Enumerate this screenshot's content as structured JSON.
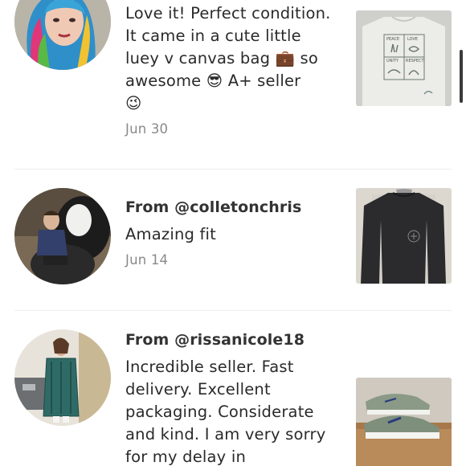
{
  "reviews": [
    {
      "from": "",
      "lines": [
        "Love it! Perfect condition.",
        "It came in a cute little",
        "luey v canvas bag 💼 so",
        "awesome 😎 A+ seller",
        "😉"
      ],
      "date": "Jun 30",
      "thumb_text": [
        "PEACE",
        "LOVE",
        "UNITY",
        "RESPECT"
      ]
    },
    {
      "from": "From @colletonchris",
      "lines": [
        "Amazing fit"
      ],
      "date": "Jun 14"
    },
    {
      "from": "From @rissanicole18",
      "lines": [
        "Incredible seller. Fast",
        "delivery. Excellent",
        "packaging. Considerate",
        "and kind.   I am very sorry",
        "for my delay in"
      ],
      "date": ""
    }
  ],
  "colors": {
    "divider": "#ececec",
    "date": "#8a8a8a",
    "text": "#2a2a2a"
  }
}
